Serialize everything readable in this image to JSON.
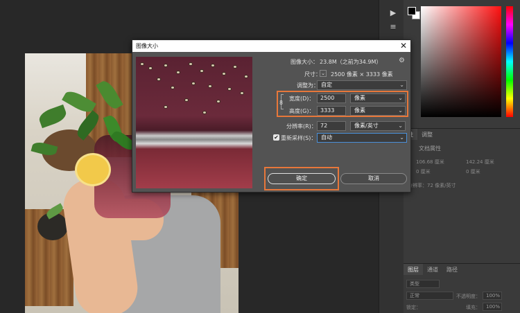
{
  "dialog": {
    "title": "图像大小",
    "close_glyph": "✕",
    "image_size_label": "图像大小：",
    "image_size_value": "23.8M（之前为34.9M）",
    "gear_glyph": "⚙",
    "dimensions_label": "尺寸：",
    "dimensions_value": "2500 像素 × 3333 像素",
    "fit_to_label": "调整为：",
    "fit_to_value": "自定",
    "width_label": "宽度(D)：",
    "width_value": "2500",
    "width_unit": "像素",
    "height_label": "高度(G)：",
    "height_value": "3333",
    "height_unit": "像素",
    "resolution_label": "分辨率(R)：",
    "resolution_value": "72",
    "resolution_unit": "像素/英寸",
    "resample_label": "重新采样(S)：",
    "resample_checked": true,
    "resample_check_glyph": "✔",
    "resample_value": "自动",
    "ok_label": "确定",
    "cancel_label": "取消",
    "link_glyph": "8",
    "dropdown_glyph": "⌄"
  },
  "tool_strip": {
    "play_glyph": "▶",
    "menu_glyph": "≡"
  },
  "properties_panel": {
    "tabs": [
      "性",
      "调整"
    ],
    "doc_label": "文档属性",
    "w_value": "106.68 厘米",
    "h_value": "142.24 厘米",
    "x_value": "0 厘米",
    "y_value": "0 厘米",
    "resolution_text": "分辨率：72 像素/英寸"
  },
  "layers_panel": {
    "tabs": [
      "图层",
      "通道",
      "路径"
    ],
    "filter_value": "类型",
    "blend_mode": "正常",
    "opacity_label": "不透明度：",
    "opacity_value": "100%",
    "lock_label": "锁定：",
    "fill_label": "填充：",
    "fill_value": "100%"
  }
}
